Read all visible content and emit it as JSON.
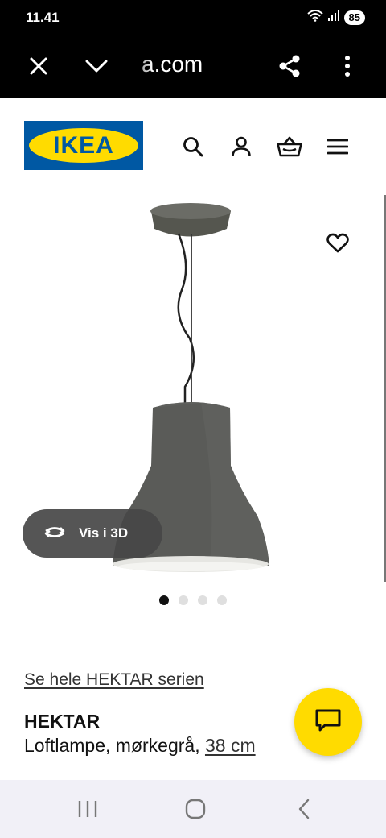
{
  "status_bar": {
    "time": "11.41",
    "battery": "85",
    "icons": [
      "wifi-icon",
      "signal-icon"
    ]
  },
  "browser": {
    "url": "a.com",
    "icons": [
      "close-icon",
      "chevron-down-icon",
      "share-icon",
      "more-vertical-icon"
    ]
  },
  "header": {
    "logo_text": "IKEA",
    "icons": [
      "search-icon",
      "account-icon",
      "basket-icon",
      "menu-icon"
    ]
  },
  "gallery": {
    "favorite_icon": "heart-icon",
    "view_3d_label": "Vis i 3D",
    "view_3d_icon": "rotate-3d-icon",
    "image_count": 4,
    "active_image": 1
  },
  "product": {
    "series_link": "Se hele HEKTAR serien",
    "name": "HEKTAR",
    "description": "Loftlampe, mørkegrå, ",
    "size": "38 cm"
  },
  "chat": {
    "icon": "chat-icon"
  },
  "android_nav": {
    "icons": [
      "recents-icon",
      "home-icon",
      "back-icon"
    ]
  },
  "colors": {
    "ikea_blue": "#0058a3",
    "ikea_yellow": "#ffdb00",
    "lamp_gray": "#5a5b58"
  }
}
